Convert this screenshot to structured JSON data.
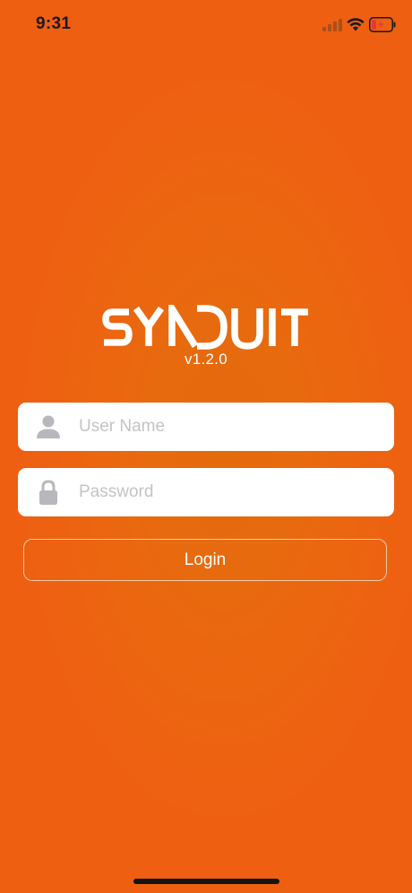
{
  "status_bar": {
    "time": "9:31",
    "signal_icon": "cellular-signal-icon",
    "wifi_icon": "wifi-icon",
    "battery_icon": "battery-charging-icon",
    "battery_level": 0.15
  },
  "brand": {
    "logo_text": "SYNDUIT",
    "version": "v1.2.0"
  },
  "login_form": {
    "username": {
      "placeholder": "User Name",
      "value": "",
      "icon": "user-icon"
    },
    "password": {
      "placeholder": "Password",
      "value": "",
      "icon": "lock-icon"
    },
    "login_label": "Login"
  },
  "colors": {
    "background": "#ec6510",
    "text_on_background": "#ffffff",
    "input_background": "#ffffff",
    "placeholder": "#c4c4c6",
    "icon_gray": "#b8b8bc",
    "battery_low": "#e53935"
  }
}
